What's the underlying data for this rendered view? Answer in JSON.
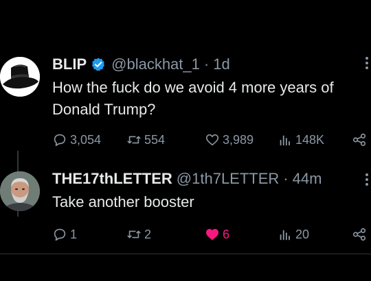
{
  "tweets": [
    {
      "display_name": "BLIP",
      "handle": "@blackhat_1",
      "separator": "·",
      "time": "1d",
      "text_lines": [
        "How the fuck do we avoid 4 more years of",
        "Donald Trump?"
      ],
      "verified": true,
      "avatar_icon": "black-hat-icon",
      "stats": {
        "replies": "3,054",
        "retweets": "554",
        "likes": "3,989",
        "views": "148K"
      }
    },
    {
      "display_name": "THE17thLETTER",
      "handle": "@1th7LETTER",
      "separator": "·",
      "time": "44m",
      "text_lines": [
        "Take another booster"
      ],
      "verified": false,
      "avatar_icon": "bearded-man-photo",
      "liked": true,
      "stats": {
        "replies": "1",
        "retweets": "2",
        "likes": "6",
        "views": "20"
      }
    }
  ],
  "colors": {
    "background": "#000000",
    "text": "#e7e9ea",
    "secondary": "#8b98a5",
    "verified_badge": "#1d9bf0",
    "like_active": "#f91880"
  }
}
